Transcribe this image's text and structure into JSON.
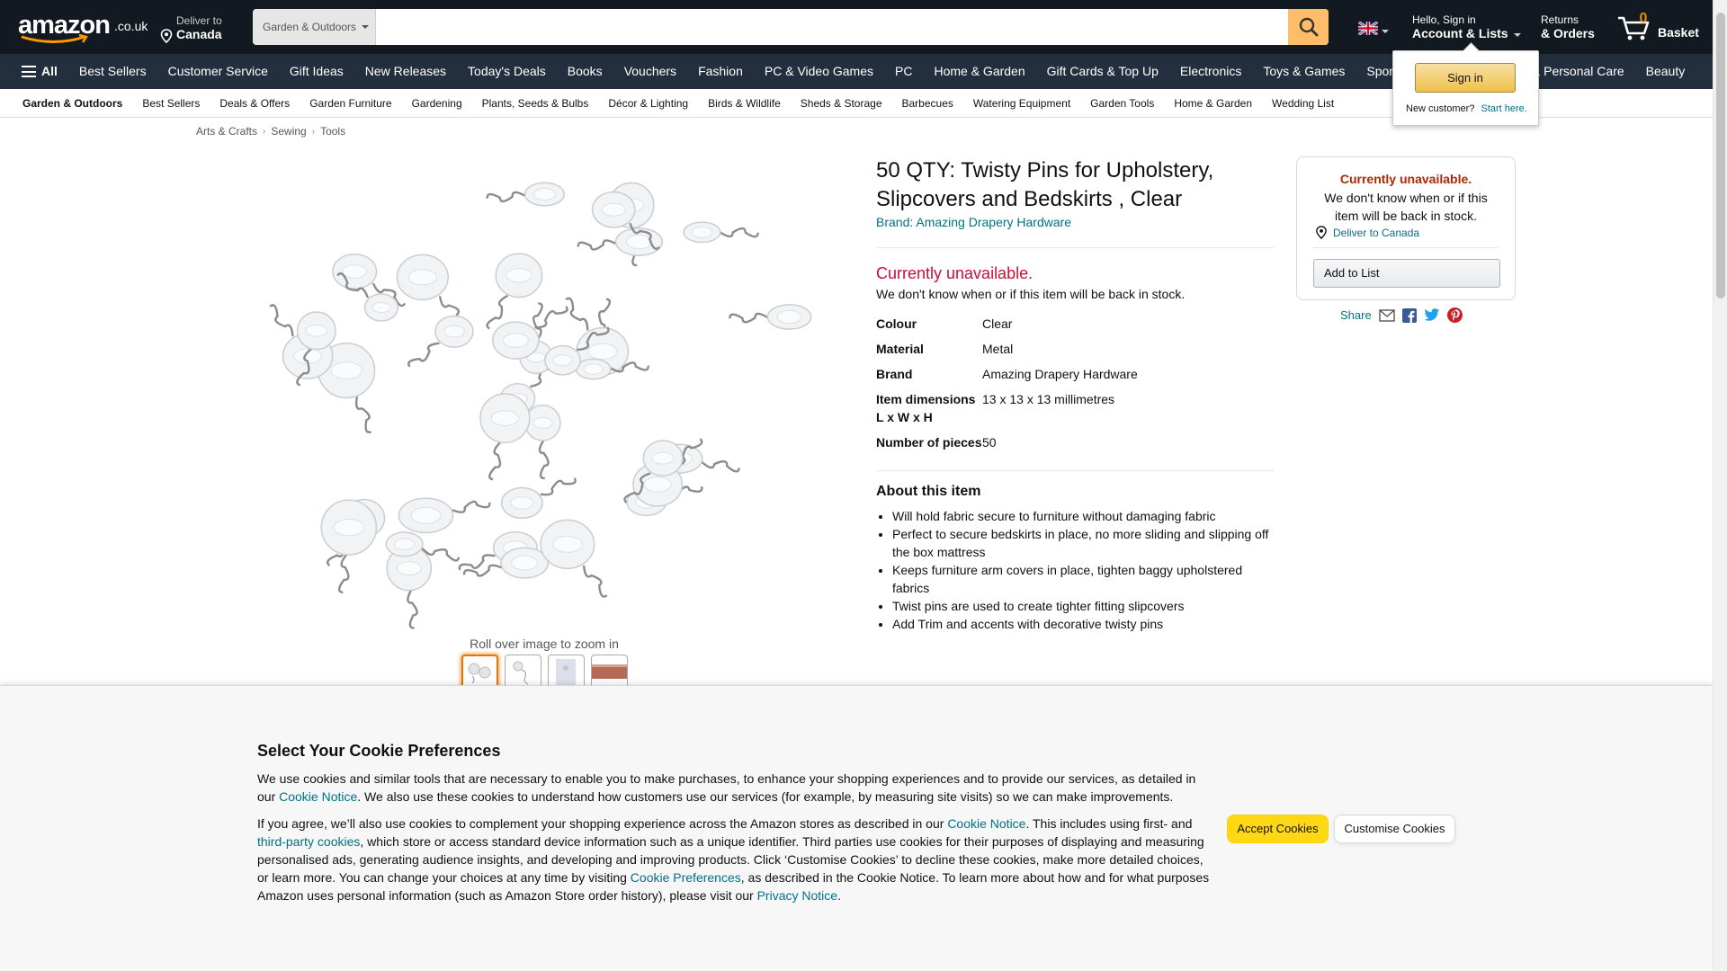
{
  "header": {
    "logo_text": "amazon",
    "logo_tld": ".co.uk",
    "deliver_line1": "Deliver to",
    "deliver_line2": "Canada",
    "search_category": "Garden & Outdoors",
    "search_placeholder": "",
    "account_line1": "Hello, Sign in",
    "account_line2": "Account & Lists",
    "returns_line1": "Returns",
    "returns_line2": "& Orders",
    "basket_count": "0",
    "basket_label": "Basket"
  },
  "main_nav": {
    "all_label": "All",
    "items": [
      "Best Sellers",
      "Customer Service",
      "Gift Ideas",
      "New Releases",
      "Today's Deals",
      "Books",
      "Vouchers",
      "Fashion",
      "PC & Video Games",
      "PC",
      "Home & Garden",
      "Gift Cards & Top Up",
      "Electronics",
      "Toys & Games",
      "Sports & Outdoors",
      "Health & Personal Care",
      "Beauty"
    ]
  },
  "sub_nav": {
    "items": [
      "Garden & Outdoors",
      "Best Sellers",
      "Deals & Offers",
      "Garden Furniture",
      "Gardening",
      "Plants, Seeds & Bulbs",
      "Décor & Lighting",
      "Birds & Wildlife",
      "Sheds & Storage",
      "Barbecues",
      "Watering Equipment",
      "Garden Tools",
      "Home & Garden",
      "Wedding List"
    ]
  },
  "breadcrumb": [
    "Arts & Crafts",
    "Sewing",
    "Tools"
  ],
  "product": {
    "zoom_hint": "Roll over image to zoom in",
    "title": "50 QTY: Twisty Pins for Upholstery, Slipcovers and Bedskirts , Clear",
    "brand_link": "Brand: Amazing Drapery Hardware",
    "unavailable": "Currently unavailable.",
    "unavailable_sub": "We don't know when or if this item will be back in stock.",
    "specs": [
      {
        "k": "Colour",
        "v": "Clear"
      },
      {
        "k": "Material",
        "v": "Metal"
      },
      {
        "k": "Brand",
        "v": "Amazing Drapery Hardware"
      },
      {
        "k": "Item dimensions L x W x H",
        "v": "13 x 13 x 13 millimetres"
      },
      {
        "k": "Number of pieces",
        "v": "50"
      }
    ],
    "about_heading": "About this item",
    "about": [
      "Will hold fabric secure to furniture without damaging fabric",
      "Perfect to secure bedskirts in place, no more sliding and slipping off the box mattress",
      "Keeps furniture arm covers in place, tighten baggy upholstered fabrics",
      "Twist pins are used to create tighter fitting slipcovers",
      "Add Trim and accents with decorative twisty pins"
    ]
  },
  "buybox": {
    "unavailable": "Currently unavailable.",
    "unavailable_sub": "We don't know when or if this item will be back in stock.",
    "deliver": "Deliver to Canada",
    "add_to_list": "Add to List",
    "share": "Share"
  },
  "flyout": {
    "sign_in": "Sign in",
    "new_customer": "New customer?",
    "start_here": "Start here."
  },
  "cookie": {
    "heading": "Select Your Cookie Preferences",
    "p1_a": "We use cookies and similar tools that are necessary to enable you to make purchases, to enhance your shopping experiences and to provide our services, as detailed in our ",
    "p1_link": "Cookie Notice",
    "p1_b": ". We also use these cookies to understand how customers use our services (for example, by measuring site visits) so we can make improvements.",
    "p2_a": "If you agree, we’ll also use cookies to complement your shopping experience across the Amazon stores as described in our ",
    "p2_link1": "Cookie Notice",
    "p2_b": ". This includes using first- and ",
    "p2_link2": "third-party cookies",
    "p2_c": ", which store or access standard device information such as a unique identifier. Third parties use cookies for their purposes of displaying and measuring personalised ads, generating audience insights, and developing and improving products. Click ‘Customise Cookies’ to decline these cookies, make more detailed choices, or learn more. You can change your choices at any time by visiting ",
    "p2_link3": "Cookie Preferences",
    "p2_d": ", as described in the Cookie Notice. To learn more about how and for what purposes Amazon uses personal information (such as Amazon Store order history), please visit our ",
    "p2_link4": "Privacy Notice",
    "p2_e": ".",
    "accept": "Accept Cookies",
    "customise": "Customise Cookies"
  },
  "colors": {
    "nav_dark": "#131921",
    "nav_secondary": "#232f3e",
    "search_button": "#febd69",
    "link": "#007185",
    "unavailable_red": "#cc0c39",
    "accept_yellow": "#ffd814"
  }
}
